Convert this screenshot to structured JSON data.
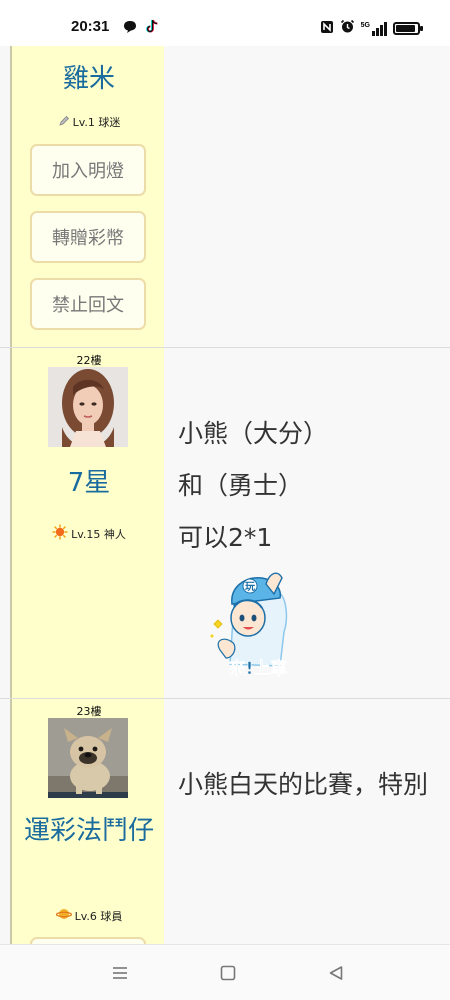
{
  "status_bar": {
    "time": "20:31",
    "left_icons": [
      "chat-bubble-icon",
      "tiktok-icon"
    ],
    "right_icons": [
      "nfc-icon",
      "alarm-icon",
      "5g-signal-icon",
      "battery-icon"
    ],
    "network_tag": "5G",
    "battery_level": 0.9
  },
  "posts": [
    {
      "username": "雞米",
      "level": "Lv.1 球迷",
      "level_icon": "pencil-icon",
      "actions": [
        "加入明燈",
        "轉贈彩幣",
        "禁止回文"
      ]
    },
    {
      "floor": "22樓",
      "avatar": "user-photo-avatar",
      "username": "7星",
      "level": "Lv.15 神人",
      "level_icon": "sun-badge-icon",
      "lines": [
        "小熊（大分）",
        "和（勇士）",
        "可以2*1"
      ],
      "sticker": {
        "name": "come-aboard-sticker",
        "cap_text": "玩",
        "text": "來!上車"
      }
    },
    {
      "floor": "23樓",
      "avatar": "dog-photo-avatar",
      "username": "運彩法鬥仔",
      "level": "Lv.6 球員",
      "level_icon": "planet-badge-icon",
      "lines": [
        "小熊白天的比賽，特別"
      ]
    }
  ],
  "nav_bar": {
    "buttons": [
      "menu-icon",
      "home-icon",
      "back-icon"
    ]
  },
  "colors": {
    "sidebar_bg": "#ffffcc",
    "username": "#1a6b9e",
    "button_border": "#ecdca8"
  }
}
